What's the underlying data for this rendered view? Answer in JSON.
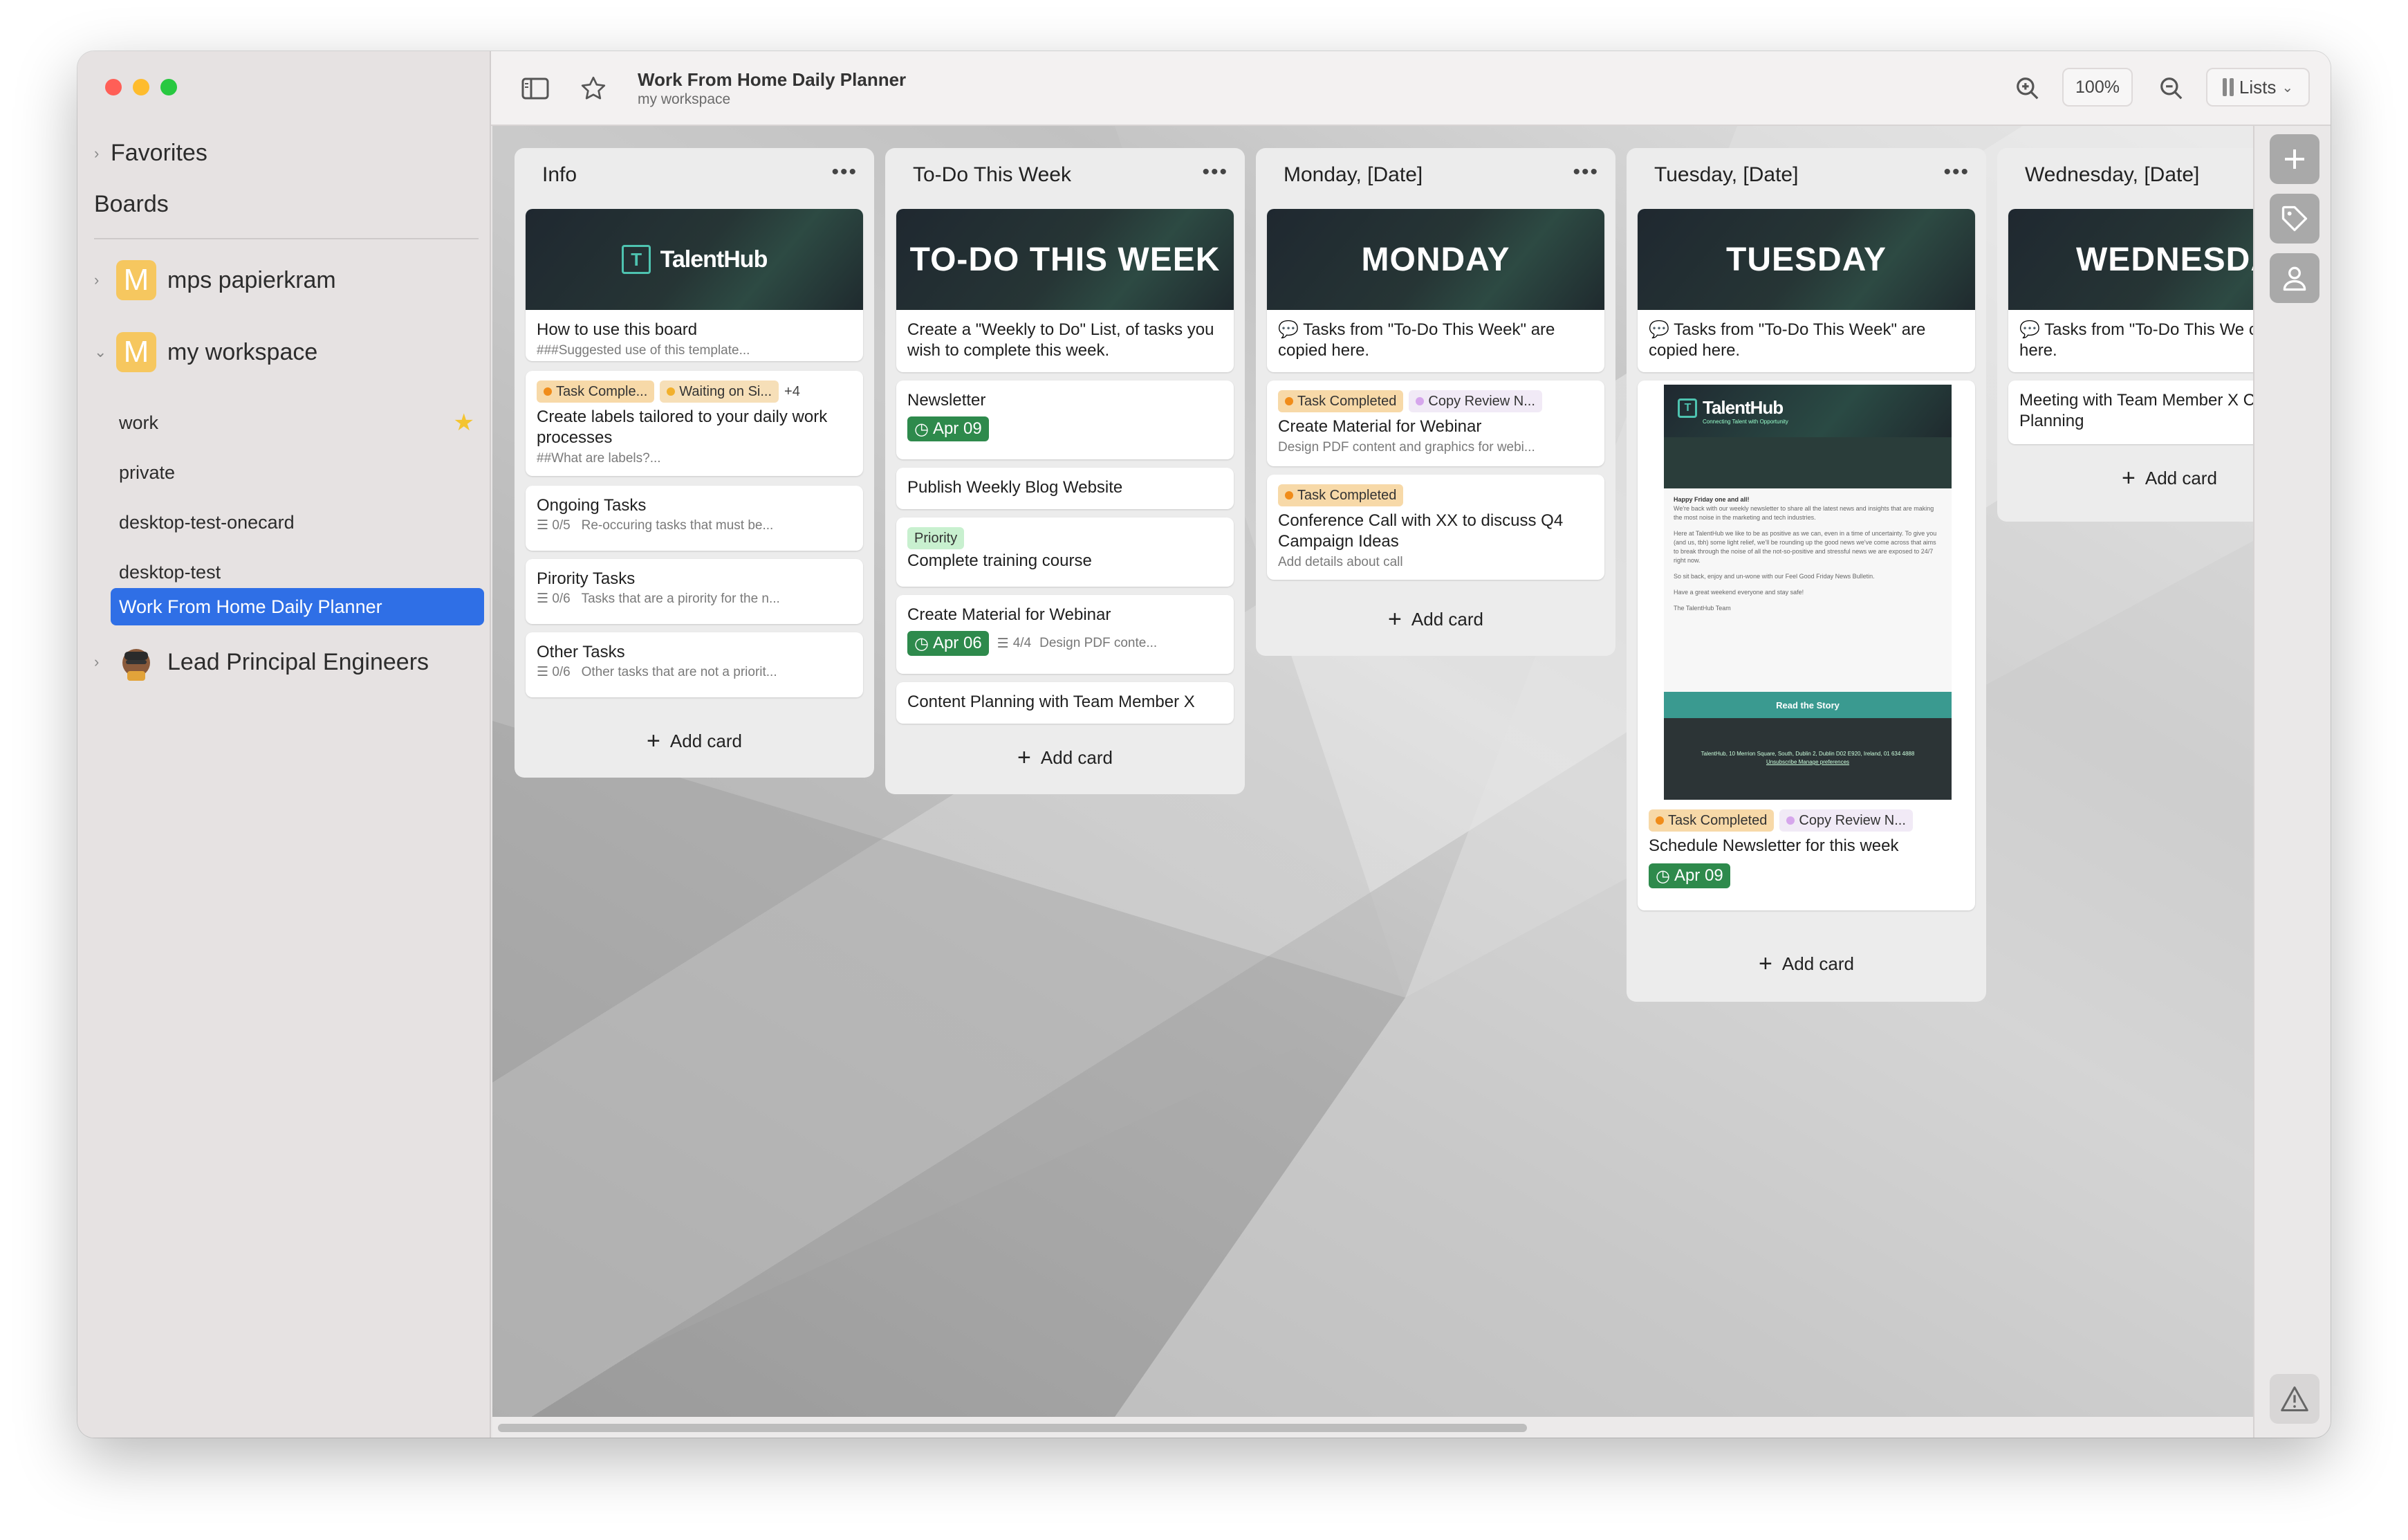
{
  "colors": {
    "accent": "#2f6fe6",
    "date_badge": "#2e8a4c",
    "label_orange": "#f08c1a",
    "label_purple": "#d6a6ec",
    "label_green": "#c8f0cf"
  },
  "sidebar": {
    "favorites": "Favorites",
    "boards": "Boards",
    "workspaces": [
      {
        "icon": "M",
        "name": "mps papierkram"
      },
      {
        "icon": "M",
        "name": "my workspace"
      }
    ],
    "items": [
      "work",
      "private",
      "desktop-test-onecard",
      "desktop-test",
      "Work From Home Daily Planner"
    ],
    "lead": "Lead Principal Engineers"
  },
  "header": {
    "title": "Work From Home Daily Planner",
    "subtitle": "my workspace",
    "zoom": "100%",
    "view": "Lists"
  },
  "lists": {
    "info": {
      "title": "Info",
      "cover_logo": "TalentHub",
      "c1_title": "How to use this board",
      "c1_desc": "###Suggested use of this template...",
      "c2_label1": "Task Comple...",
      "c2_label2": "Waiting on Si...",
      "c2_more": "+4",
      "c2_title": "Create labels tailored to your daily work processes",
      "c2_desc": "##What are labels?...",
      "c3_title": "Ongoing Tasks",
      "c3_check": "0/5",
      "c3_desc": "Re-occuring tasks that must be...",
      "c4_title": "Pirority Tasks",
      "c4_check": "0/6",
      "c4_desc": "Tasks that are a pirority for the n...",
      "c5_title": "Other Tasks",
      "c5_check": "0/6",
      "c5_desc": "Other tasks that are not a priorit...",
      "add": "Add card"
    },
    "todo": {
      "title": "To-Do This Week",
      "cover": "TO-DO THIS WEEK",
      "c1_title": "Create a \"Weekly to Do\" List, of tasks you wish to complete this week.",
      "c2_title": "Newsletter",
      "c2_date": "Apr 09",
      "c3_title": "Publish Weekly Blog Website",
      "c4_label": "Priority",
      "c4_title": "Complete training course",
      "c5_title": "Create Material for Webinar",
      "c5_date": "Apr 06",
      "c5_check": "4/4",
      "c5_desc": "Design PDF conte...",
      "c6_title": "Content Planning with Team Member X",
      "add": "Add card"
    },
    "monday": {
      "title": "Monday, [Date]",
      "cover": "MONDAY",
      "c1_title": "Tasks from \"To-Do This Week\" are copied here.",
      "c2_label1": "Task Completed",
      "c2_label2": "Copy Review N...",
      "c2_title": "Create Material for Webinar",
      "c2_desc": "Design PDF content and graphics for webi...",
      "c3_label1": "Task Completed",
      "c3_title": "Conference Call with XX to discuss Q4 Campaign Ideas",
      "c3_desc": "Add details about call",
      "add": "Add card"
    },
    "tuesday": {
      "title": "Tuesday, [Date]",
      "cover": "TUESDAY",
      "c1_title": "Tasks from \"To-Do This Week\" are copied here.",
      "news_logo": "TalentHub",
      "news_tagline": "Connecting Talent with Opportunity",
      "news_greeting": "Happy Friday one and all!",
      "news_p1": "We're back with our weekly newsletter to share all the latest news and insights that are making the most noise in the marketing and tech industries.",
      "news_p2": "Here at TalentHub we like to be as positive as we can, even in a time of uncertainty. To give you (and us, tbh) some light relief, we'll be rounding up the good news we've come across that aims to break through the noise of all the not-so-positive and stressful news we are exposed to 24/7 right now.",
      "news_p3": "So sit back, enjoy and un-wone with our Feel Good Friday News Bulletin.",
      "news_p4": "Have a great weekend everyone and stay safe!",
      "news_sign": "The TalentHub Team",
      "news_cta": "Read the Story",
      "news_footer": "TalentHub, 10 Merrion Square, South, Dublin 2, Dublin D02 E920, Ireland, 01 634 4888",
      "news_links": "Unsubscribe  Manage preferences",
      "c2_label1": "Task Completed",
      "c2_label2": "Copy Review N...",
      "c2_title": "Schedule Newsletter for this week",
      "c2_date": "Apr 09",
      "add": "Add card"
    },
    "wednesday": {
      "title": "Wednesday, [Date]",
      "cover": "WEDNESDA",
      "c1_title": "Tasks from \"To-Do This We copied here.",
      "c2_title": "Meeting with Team Member X Content Planning",
      "add": "Add card"
    }
  }
}
